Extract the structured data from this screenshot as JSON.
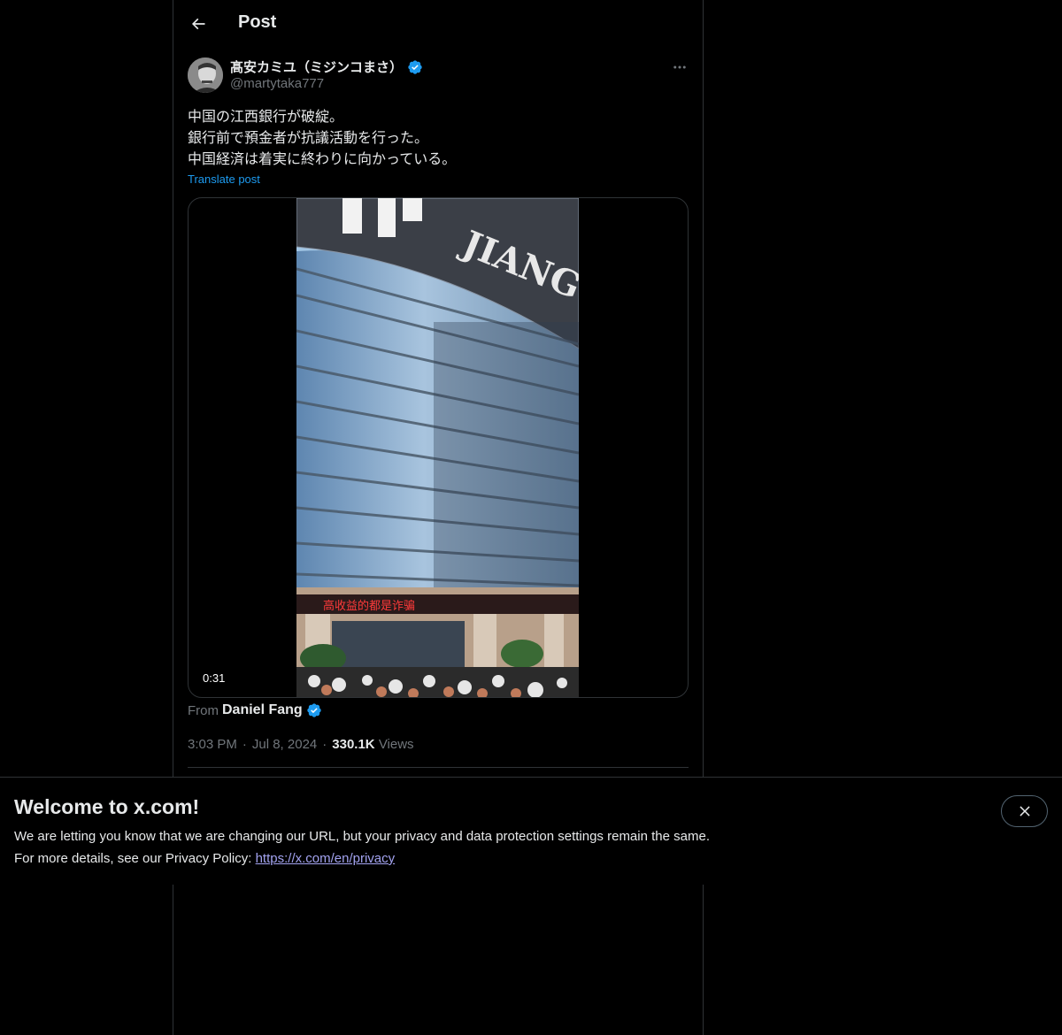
{
  "header": {
    "title": "Post"
  },
  "post": {
    "author": {
      "name": "髙安カミユ（ミジンコまさ）",
      "handle": "@martytaka777",
      "verified": true
    },
    "text_lines": [
      "中国の江西銀行が破綻。",
      "銀行前で預金者が抗議活動を行った。",
      "中国経済は着実に終わりに向かっている。"
    ],
    "translate_label": "Translate post",
    "video": {
      "duration": "0:31",
      "sign_text": "JIANG",
      "banner_text": "高收益的都是诈骗"
    },
    "source": {
      "prefix": "From",
      "name": "Daniel Fang",
      "verified": true
    },
    "time": "3:03 PM",
    "date": "Jul 8, 2024",
    "separator": "·",
    "views_count": "330.1K",
    "views_label": "Views"
  },
  "banner": {
    "title": "Welcome to x.com!",
    "line1": "We are letting you know that we are changing our URL, but your privacy and data protection settings remain the same.",
    "line2_prefix": "For more details, see our Privacy Policy: ",
    "link_text": "https://x.com/en/privacy"
  },
  "colors": {
    "background": "#000000",
    "text_primary": "#e7e9ea",
    "text_secondary": "#71767b",
    "accent": "#1d9bf0",
    "border": "#2f3336"
  },
  "icons": {
    "back": "arrow-left-icon",
    "more": "more-horizontal-icon",
    "verified": "verified-badge-icon",
    "close": "close-icon"
  }
}
